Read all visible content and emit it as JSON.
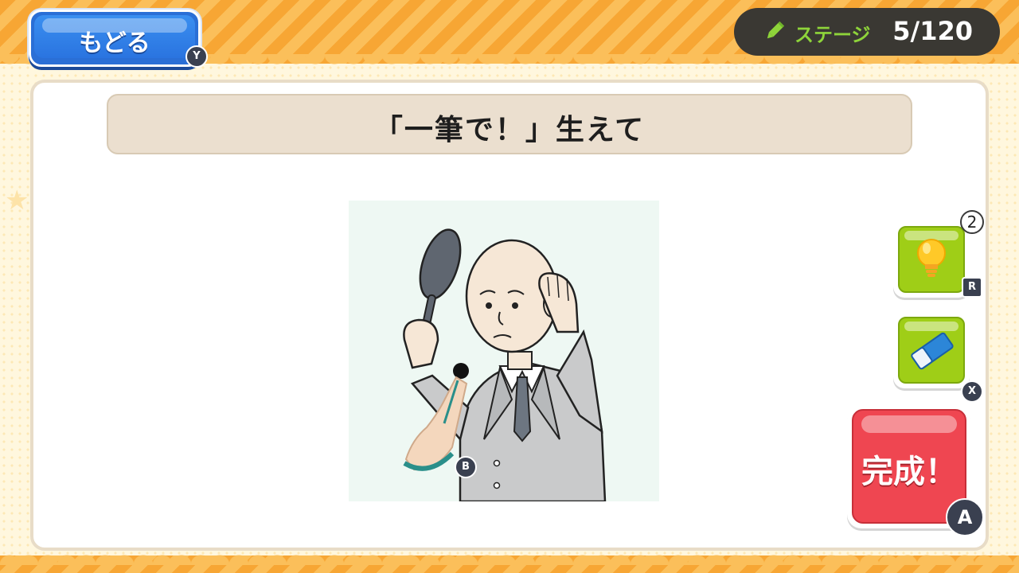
{
  "header": {
    "back_label": "もどる",
    "back_key": "Y",
    "stage_label": "ステージ",
    "stage_count": "5/120"
  },
  "prompt": {
    "text": "「一筆で！」生えて"
  },
  "tools": {
    "hint_count": "2",
    "hint_key": "R",
    "eraser_key": "X",
    "done_label": "完成！",
    "done_key": "A"
  },
  "cursor": {
    "key": "B"
  },
  "colors": {
    "accent_orange": "#f7a634",
    "back_blue": "#2a74e0",
    "tool_green": "#9fce17",
    "done_red": "#ef4651",
    "stage_green": "#8ed43a"
  }
}
